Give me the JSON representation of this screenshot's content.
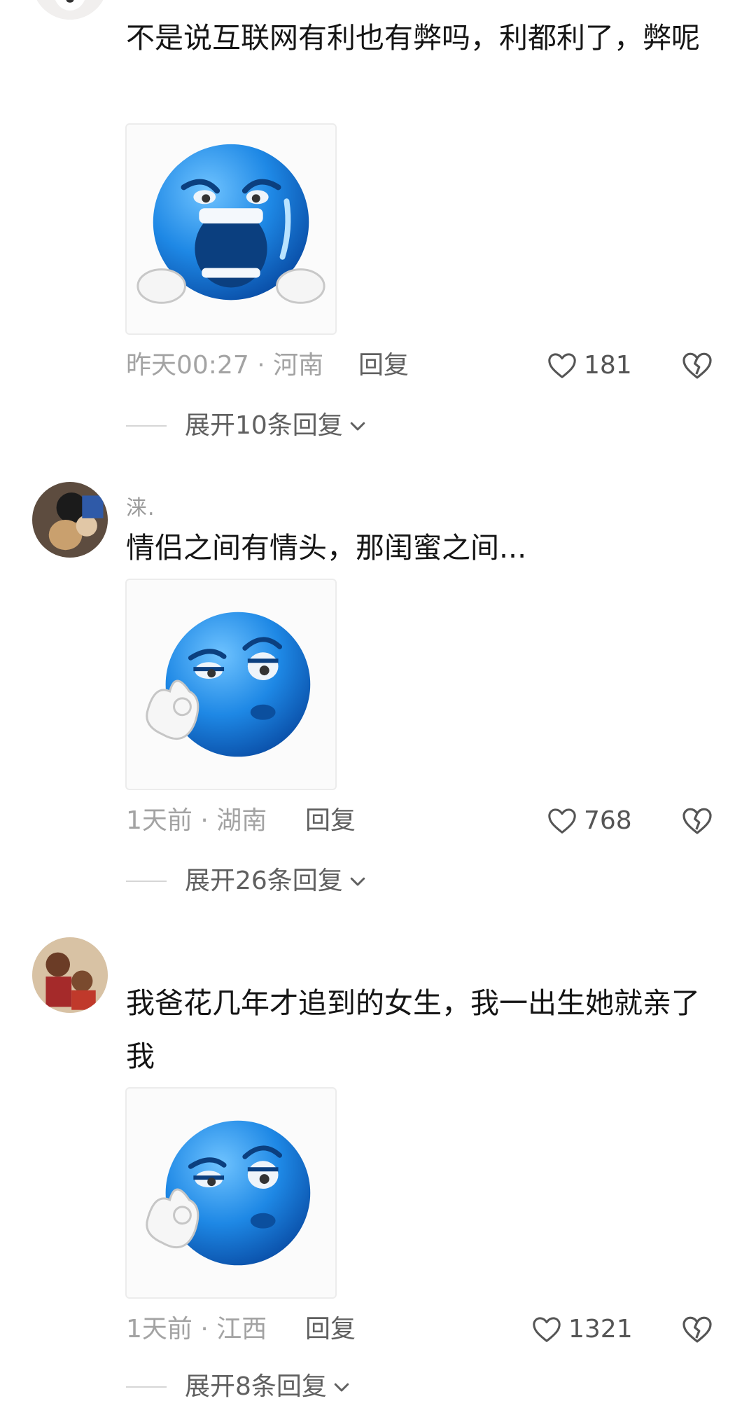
{
  "comments": [
    {
      "username": "",
      "text": "不是说互联网有利也有弊吗，利都利了，弊呢",
      "sticker": "crying-blue-emoji",
      "time_location": "昨天00:27 · 河南",
      "reply_label": "回复",
      "likes": "181",
      "expand_label": "展开10条回复"
    },
    {
      "username": "涞.",
      "text": "情侣之间有情头，那闺蜜之间...",
      "sticker": "ok-hand-blue-emoji",
      "time_location": "1天前 · 湖南",
      "reply_label": "回复",
      "likes": "768",
      "expand_label": "展开26条回复"
    },
    {
      "username": "",
      "text": "我爸花几年才追到的女生，我一出生她就亲了我",
      "sticker": "ok-hand-blue-emoji",
      "time_location": "1天前 · 江西",
      "reply_label": "回复",
      "likes": "1321",
      "expand_label": "展开8条回复"
    }
  ],
  "icons": {
    "like": "heart-outline-icon",
    "dislike": "broken-heart-icon",
    "expand": "chevron-down-icon"
  },
  "colors": {
    "background": "#ffffff",
    "meta_text": "#a3a3a3",
    "emoji_blue": "#1e88e5"
  }
}
